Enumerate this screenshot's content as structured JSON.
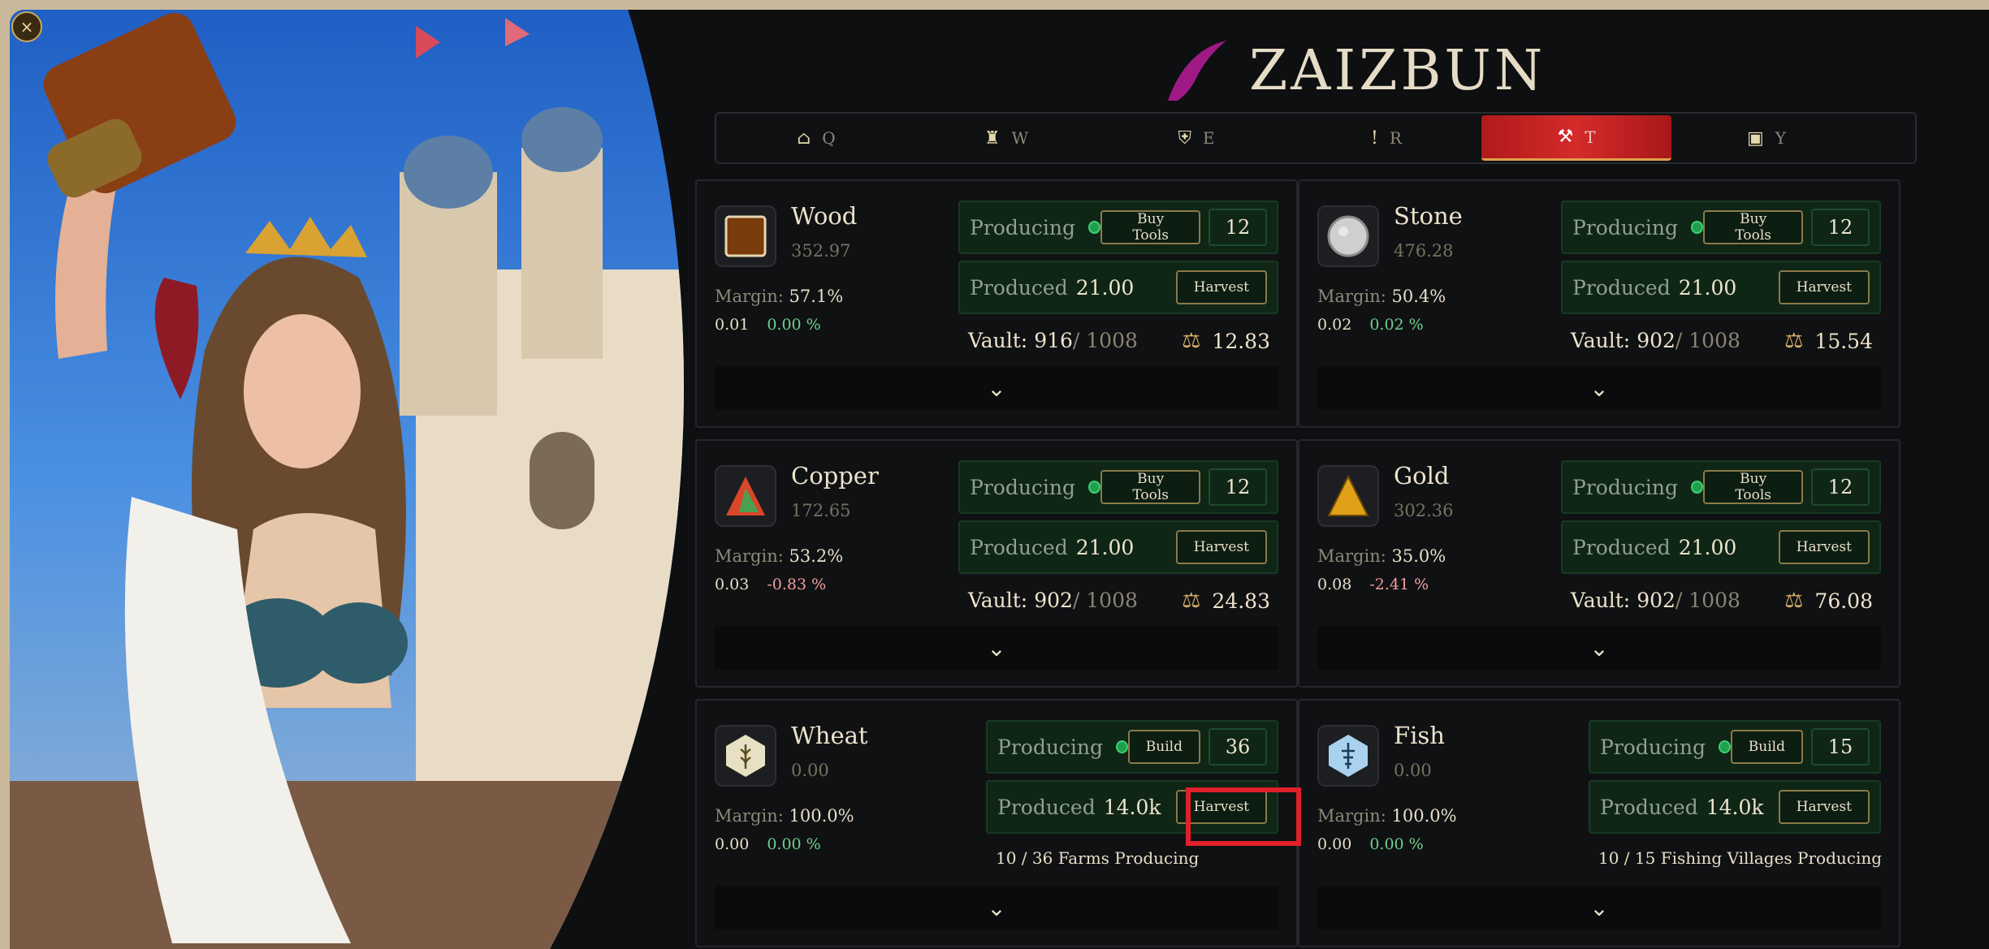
{
  "app": {
    "title": "ZAIZBUN",
    "close_label": "×"
  },
  "nav": {
    "tabs": [
      {
        "icon": "house-icon",
        "glyph": "⌂",
        "key": "Q",
        "active": false
      },
      {
        "icon": "tower-icon",
        "glyph": "♜",
        "key": "W",
        "active": false
      },
      {
        "icon": "shield-icon",
        "glyph": "⛨",
        "key": "E",
        "active": false
      },
      {
        "icon": "exclamation-icon",
        "glyph": "!",
        "key": "R",
        "active": false
      },
      {
        "icon": "pickaxe-icon",
        "glyph": "⚒",
        "key": "T",
        "active": true
      },
      {
        "icon": "book-icon",
        "glyph": "▣",
        "key": "Y",
        "active": false
      }
    ]
  },
  "labels": {
    "producing": "Producing",
    "produced": "Produced",
    "buy_tools": "Buy Tools",
    "build": "Build",
    "harvest": "Harvest",
    "margin": "Margin:",
    "vault": "Vault:",
    "expand": "⌄"
  },
  "colors": {
    "accent": "#d42a2a",
    "producing_dot": "#1fa04e",
    "panel_bg": "#0f2616",
    "up": "#6fcf8f",
    "down": "#f19d9d"
  },
  "resources": [
    {
      "name": "Wood",
      "price": "352.97",
      "margin": "57.1%",
      "stat": "0.01",
      "change": "0.00 %",
      "trend": "up",
      "action": "Buy Tools",
      "count": "12",
      "produced": "21.00",
      "vault": "916",
      "vault_cap": "/ 1008",
      "tax": "12.83",
      "icon": "wood-icon"
    },
    {
      "name": "Stone",
      "price": "476.28",
      "margin": "50.4%",
      "stat": "0.02",
      "change": "0.02 %",
      "trend": "up",
      "action": "Buy Tools",
      "count": "12",
      "produced": "21.00",
      "vault": "902",
      "vault_cap": "/ 1008",
      "tax": "15.54",
      "icon": "stone-icon"
    },
    {
      "name": "Copper",
      "price": "172.65",
      "margin": "53.2%",
      "stat": "0.03",
      "change": "-0.83 %",
      "trend": "down",
      "action": "Buy Tools",
      "count": "12",
      "produced": "21.00",
      "vault": "902",
      "vault_cap": "/ 1008",
      "tax": "24.83",
      "icon": "copper-icon"
    },
    {
      "name": "Gold",
      "price": "302.36",
      "margin": "35.0%",
      "stat": "0.08",
      "change": "-2.41 %",
      "trend": "down",
      "action": "Buy Tools",
      "count": "12",
      "produced": "21.00",
      "vault": "902",
      "vault_cap": "/ 1008",
      "tax": "76.08",
      "icon": "gold-icon"
    },
    {
      "name": "Wheat",
      "price": "0.00",
      "margin": "100.0%",
      "stat": "0.00",
      "change": "0.00 %",
      "trend": "up",
      "action": "Build",
      "count": "36",
      "produced": "14.0k",
      "status": "10 / 36 Farms Producing",
      "icon": "wheat-icon"
    },
    {
      "name": "Fish",
      "price": "0.00",
      "margin": "100.0%",
      "stat": "0.00",
      "change": "0.00 %",
      "trend": "up",
      "action": "Build",
      "count": "15",
      "produced": "14.0k",
      "status": "10 / 15 Fishing Villages Producing",
      "icon": "fish-icon"
    }
  ]
}
